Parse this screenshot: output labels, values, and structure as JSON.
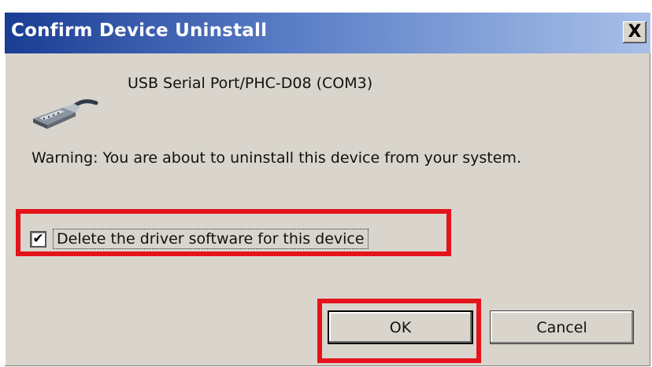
{
  "window": {
    "title": "Confirm Device Uninstall",
    "close_label": "X"
  },
  "device": {
    "name": "USB Serial Port/PHC-D08 (COM3)",
    "icon": "serial-port-connector-icon"
  },
  "warning": "Warning: You are about to uninstall this device from your system.",
  "checkbox": {
    "label": "Delete the driver software for this device",
    "checked": true,
    "check_glyph": "✔"
  },
  "buttons": {
    "ok": "OK",
    "cancel": "Cancel"
  },
  "highlight_color": "#e5131b",
  "accent_titlebar": "#1a3d94"
}
